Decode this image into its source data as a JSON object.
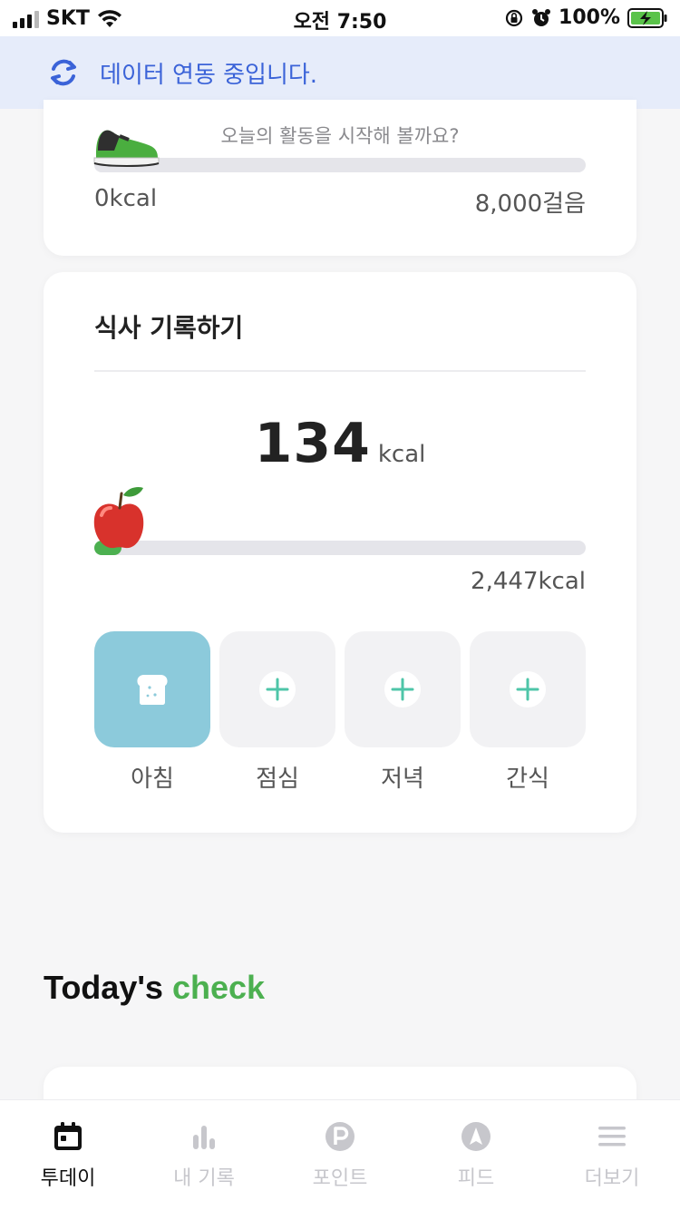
{
  "status_bar": {
    "carrier": "SKT",
    "time": "오전 7:50",
    "battery": "100%"
  },
  "sync_banner": {
    "text": "데이터 연동 중입니다.",
    "icon": "sync-icon",
    "color": "#3b63d8"
  },
  "activity": {
    "message": "오늘의 활동을 시작해 볼까요?",
    "kcal": "0kcal",
    "step_goal": "8,000걸음",
    "progress": 0
  },
  "meal": {
    "title": "식사 기록하기",
    "kcal_value": "134",
    "kcal_unit": "kcal",
    "goal": "2,447kcal",
    "progress": 0.055,
    "slots": [
      {
        "label": "아침",
        "icon": "bread-icon",
        "active": true
      },
      {
        "label": "점심",
        "icon": "plus-icon",
        "active": false
      },
      {
        "label": "저녁",
        "icon": "plus-icon",
        "active": false
      },
      {
        "label": "간식",
        "icon": "plus-icon",
        "active": false
      }
    ]
  },
  "todays_check": {
    "prefix": "Today's",
    "accent": "check"
  },
  "tabs": [
    {
      "label": "투데이",
      "icon": "calendar-icon",
      "active": true
    },
    {
      "label": "내 기록",
      "icon": "bar-chart-icon",
      "active": false
    },
    {
      "label": "포인트",
      "icon": "point-icon",
      "active": false
    },
    {
      "label": "피드",
      "icon": "compass-icon",
      "active": false
    },
    {
      "label": "더보기",
      "icon": "menu-icon",
      "active": false
    }
  ],
  "colors": {
    "accent_green": "#4cb050",
    "breakfast_tile": "#8ccadb",
    "plus_teal": "#4ec5a8"
  }
}
